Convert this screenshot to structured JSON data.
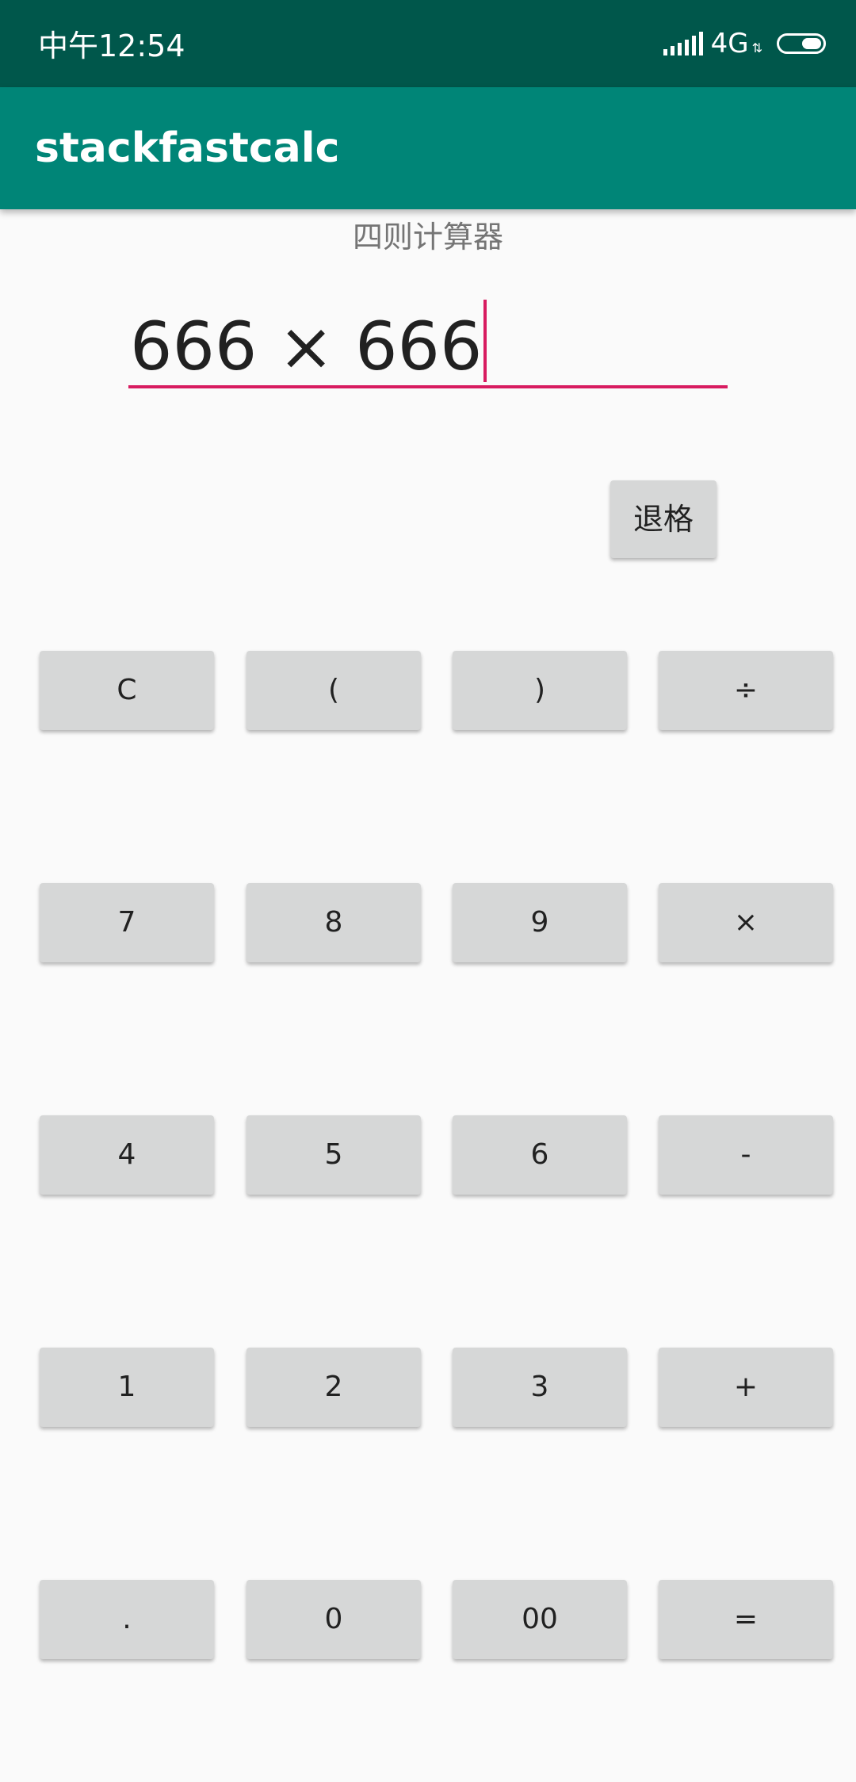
{
  "status_bar": {
    "time": "中午12:54",
    "network": "4G",
    "signal_icon": "signal-bars-icon",
    "battery_icon": "battery-icon"
  },
  "app_bar": {
    "title": "stackfastcalc"
  },
  "main": {
    "subtitle": "四则计算器",
    "expression": "666 × 666",
    "backspace_label": "退格"
  },
  "keypad": [
    [
      "C",
      "(",
      ")",
      "÷"
    ],
    [
      "7",
      "8",
      "9",
      "×"
    ],
    [
      "4",
      "5",
      "6",
      "-"
    ],
    [
      "1",
      "2",
      "3",
      "+"
    ],
    [
      ".",
      "0",
      "00",
      "="
    ]
  ],
  "colors": {
    "status_bar": "#00574b",
    "app_bar": "#008577",
    "accent": "#d81b60",
    "button": "#d6d7d7",
    "background": "#fafafa"
  }
}
